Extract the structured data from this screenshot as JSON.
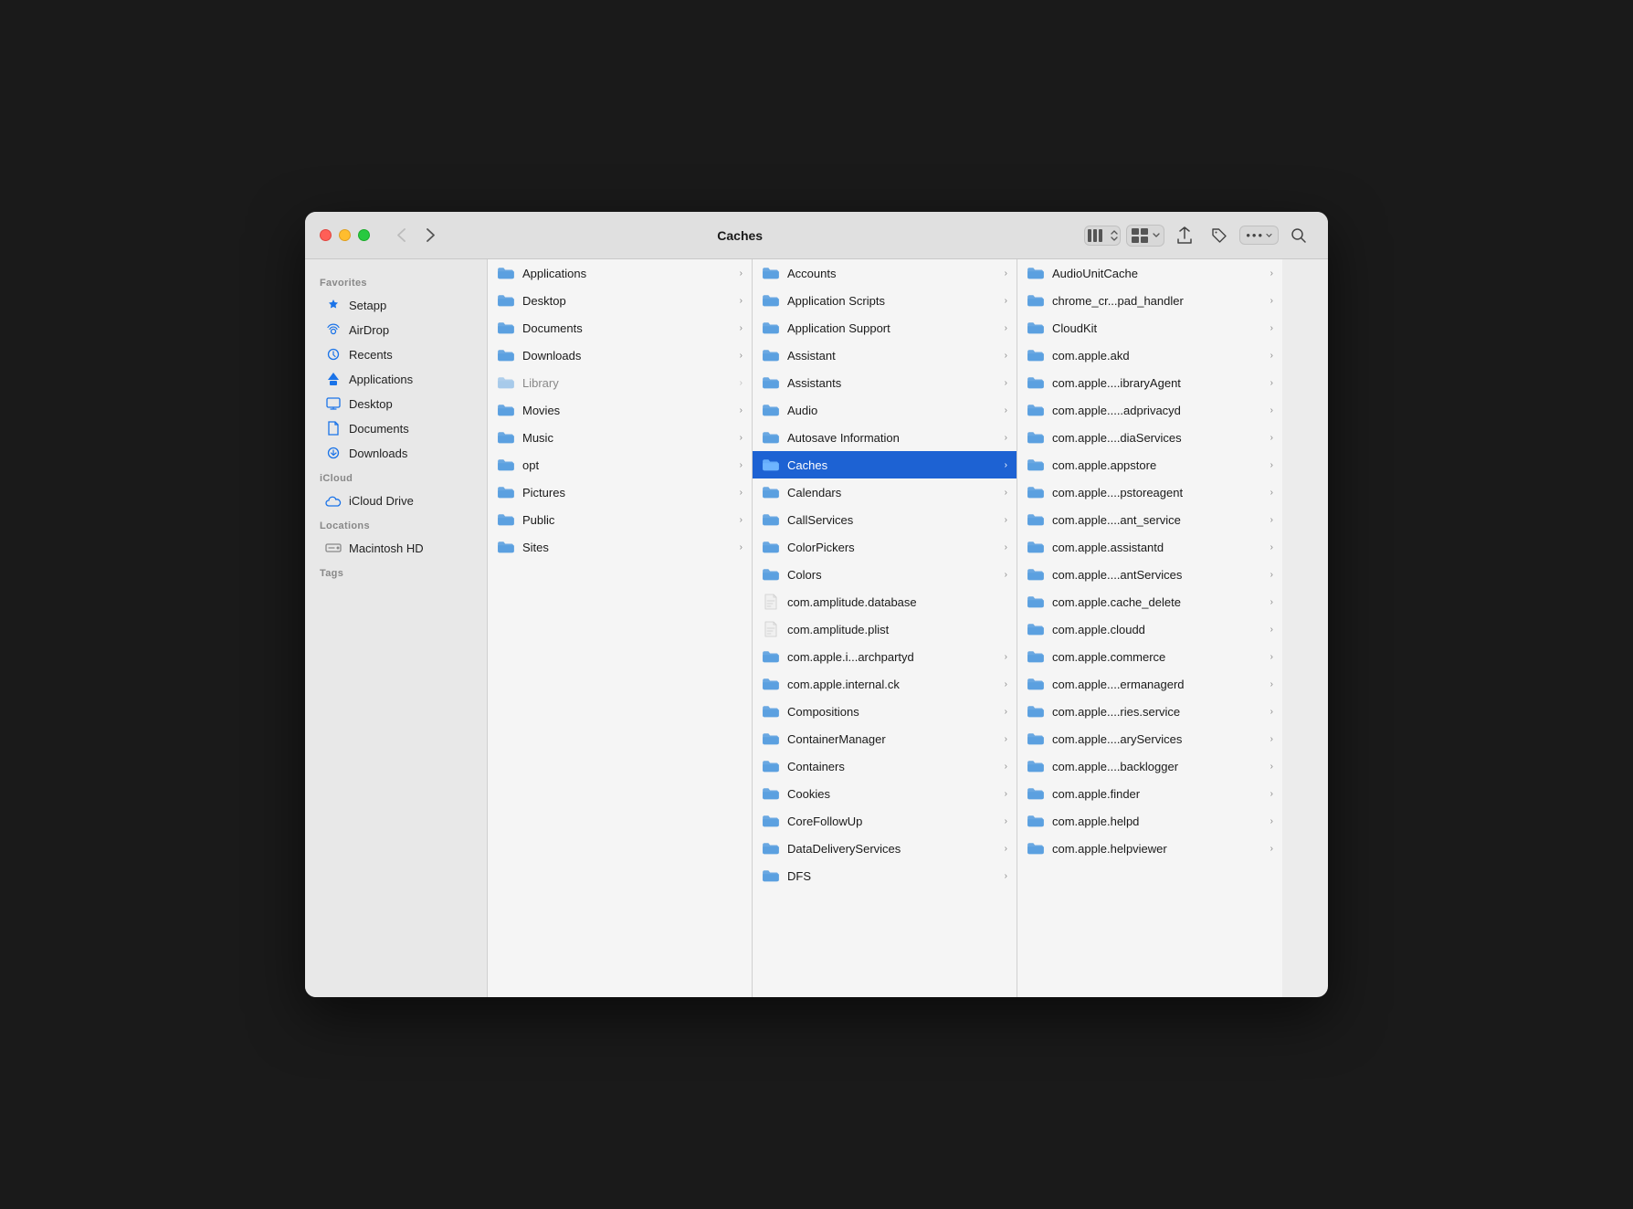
{
  "window": {
    "title": "Caches",
    "traffic_lights": {
      "red_label": "close",
      "yellow_label": "minimize",
      "green_label": "maximize"
    }
  },
  "toolbar": {
    "back_label": "‹",
    "forward_label": "›",
    "view_columns_icon": "⊞",
    "view_grid_icon": "⊞",
    "share_icon": "↑",
    "tag_icon": "🏷",
    "more_icon": "···",
    "search_icon": "⌕"
  },
  "sidebar": {
    "favorites_title": "Favorites",
    "favorites": [
      {
        "id": "setapp",
        "label": "Setapp",
        "icon": "✦",
        "color": "blue"
      },
      {
        "id": "airdrop",
        "label": "AirDrop",
        "icon": "📡",
        "color": "blue"
      },
      {
        "id": "recents",
        "label": "Recents",
        "icon": "🕐",
        "color": "blue"
      },
      {
        "id": "applications",
        "label": "Applications",
        "icon": "🚀",
        "color": "blue"
      },
      {
        "id": "desktop",
        "label": "Desktop",
        "icon": "🖥",
        "color": "blue"
      },
      {
        "id": "documents",
        "label": "Documents",
        "icon": "📄",
        "color": "blue"
      },
      {
        "id": "downloads",
        "label": "Downloads",
        "icon": "⬇",
        "color": "blue"
      }
    ],
    "icloud_title": "iCloud",
    "icloud": [
      {
        "id": "icloud-drive",
        "label": "iCloud Drive",
        "icon": "☁",
        "color": "blue"
      }
    ],
    "locations_title": "Locations",
    "locations": [
      {
        "id": "macintosh-hd",
        "label": "Macintosh HD",
        "icon": "🖴",
        "color": "gray"
      }
    ],
    "tags_title": "Tags"
  },
  "columns": {
    "col1": {
      "items": [
        {
          "id": "applications",
          "name": "Applications",
          "type": "folder",
          "hasArrow": true
        },
        {
          "id": "desktop",
          "name": "Desktop",
          "type": "folder",
          "hasArrow": true
        },
        {
          "id": "documents",
          "name": "Documents",
          "type": "folder",
          "hasArrow": true
        },
        {
          "id": "downloads",
          "name": "Downloads",
          "type": "folder",
          "hasArrow": true
        },
        {
          "id": "library",
          "name": "Library",
          "type": "folder",
          "hasArrow": true,
          "grayed": true
        },
        {
          "id": "movies",
          "name": "Movies",
          "type": "folder",
          "hasArrow": true
        },
        {
          "id": "music",
          "name": "Music",
          "type": "folder",
          "hasArrow": true
        },
        {
          "id": "opt",
          "name": "opt",
          "type": "folder",
          "hasArrow": true
        },
        {
          "id": "pictures",
          "name": "Pictures",
          "type": "folder",
          "hasArrow": true
        },
        {
          "id": "public",
          "name": "Public",
          "type": "folder",
          "hasArrow": true
        },
        {
          "id": "sites",
          "name": "Sites",
          "type": "folder",
          "hasArrow": true
        }
      ]
    },
    "col2": {
      "items": [
        {
          "id": "accounts",
          "name": "Accounts",
          "type": "folder",
          "hasArrow": true
        },
        {
          "id": "application-scripts",
          "name": "Application Scripts",
          "type": "folder",
          "hasArrow": true
        },
        {
          "id": "application-support",
          "name": "Application Support",
          "type": "folder",
          "hasArrow": true
        },
        {
          "id": "assistant",
          "name": "Assistant",
          "type": "folder",
          "hasArrow": true
        },
        {
          "id": "assistants",
          "name": "Assistants",
          "type": "folder",
          "hasArrow": true
        },
        {
          "id": "audio",
          "name": "Audio",
          "type": "folder",
          "hasArrow": true
        },
        {
          "id": "autosave-information",
          "name": "Autosave Information",
          "type": "folder",
          "hasArrow": true
        },
        {
          "id": "caches",
          "name": "Caches",
          "type": "folder",
          "hasArrow": true,
          "selected": true
        },
        {
          "id": "calendars",
          "name": "Calendars",
          "type": "folder",
          "hasArrow": true
        },
        {
          "id": "callservices",
          "name": "CallServices",
          "type": "folder",
          "hasArrow": true
        },
        {
          "id": "colorpickers",
          "name": "ColorPickers",
          "type": "folder",
          "hasArrow": true
        },
        {
          "id": "colors",
          "name": "Colors",
          "type": "folder",
          "hasArrow": true
        },
        {
          "id": "com-amplitude-database",
          "name": "com.amplitude.database",
          "type": "file",
          "hasArrow": false
        },
        {
          "id": "com-amplitude-plist",
          "name": "com.amplitude.plist",
          "type": "file",
          "hasArrow": false
        },
        {
          "id": "com-apple-i-archpartyd",
          "name": "com.apple.i...archpartyd",
          "type": "folder",
          "hasArrow": true
        },
        {
          "id": "com-apple-internal-ck",
          "name": "com.apple.internal.ck",
          "type": "folder",
          "hasArrow": true
        },
        {
          "id": "compositions",
          "name": "Compositions",
          "type": "folder",
          "hasArrow": true
        },
        {
          "id": "containermanager",
          "name": "ContainerManager",
          "type": "folder",
          "hasArrow": true
        },
        {
          "id": "containers",
          "name": "Containers",
          "type": "folder",
          "hasArrow": true
        },
        {
          "id": "cookies",
          "name": "Cookies",
          "type": "folder",
          "hasArrow": true
        },
        {
          "id": "corefollowup",
          "name": "CoreFollowUp",
          "type": "folder",
          "hasArrow": true
        },
        {
          "id": "datadeliveryservices",
          "name": "DataDeliveryServices",
          "type": "folder",
          "hasArrow": true
        },
        {
          "id": "dfs",
          "name": "DFS",
          "type": "folder",
          "hasArrow": true
        }
      ]
    },
    "col3": {
      "items": [
        {
          "id": "audiounitcache",
          "name": "AudioUnitCache",
          "type": "folder",
          "hasArrow": true
        },
        {
          "id": "chrome-cr-pad-handler",
          "name": "chrome_cr...pad_handler",
          "type": "folder",
          "hasArrow": true
        },
        {
          "id": "cloudkit",
          "name": "CloudKit",
          "type": "folder",
          "hasArrow": true
        },
        {
          "id": "com-apple-akd",
          "name": "com.apple.akd",
          "type": "folder",
          "hasArrow": true
        },
        {
          "id": "com-apple-ibraryagent",
          "name": "com.apple....ibraryAgent",
          "type": "folder",
          "hasArrow": true
        },
        {
          "id": "com-apple-adprivacyd",
          "name": "com.apple.....adprivacyd",
          "type": "folder",
          "hasArrow": true
        },
        {
          "id": "com-apple-diaservices",
          "name": "com.apple....diaServices",
          "type": "folder",
          "hasArrow": true
        },
        {
          "id": "com-apple-appstore",
          "name": "com.apple.appstore",
          "type": "folder",
          "hasArrow": true
        },
        {
          "id": "com-apple-pstoreagent",
          "name": "com.apple....pstoreagent",
          "type": "folder",
          "hasArrow": true
        },
        {
          "id": "com-apple-ant-service",
          "name": "com.apple....ant_service",
          "type": "folder",
          "hasArrow": true
        },
        {
          "id": "com-apple-assistantd",
          "name": "com.apple.assistantd",
          "type": "folder",
          "hasArrow": true
        },
        {
          "id": "com-apple-antservices",
          "name": "com.apple....antServices",
          "type": "folder",
          "hasArrow": true
        },
        {
          "id": "com-apple-cache-delete",
          "name": "com.apple.cache_delete",
          "type": "folder",
          "hasArrow": true
        },
        {
          "id": "com-apple-cloudd",
          "name": "com.apple.cloudd",
          "type": "folder",
          "hasArrow": true
        },
        {
          "id": "com-apple-commerce",
          "name": "com.apple.commerce",
          "type": "folder",
          "hasArrow": true
        },
        {
          "id": "com-apple-ermanagerd",
          "name": "com.apple....ermanagerd",
          "type": "folder",
          "hasArrow": true
        },
        {
          "id": "com-apple-ries-service",
          "name": "com.apple....ries.service",
          "type": "folder",
          "hasArrow": true,
          "hasSpecialIcon": true
        },
        {
          "id": "com-apple-aryservices",
          "name": "com.apple....aryServices",
          "type": "folder",
          "hasArrow": true
        },
        {
          "id": "com-apple-backlogger",
          "name": "com.apple....backlogger",
          "type": "folder",
          "hasArrow": true
        },
        {
          "id": "com-apple-finder",
          "name": "com.apple.finder",
          "type": "folder",
          "hasArrow": true
        },
        {
          "id": "com-apple-helpd",
          "name": "com.apple.helpd",
          "type": "folder",
          "hasArrow": true
        },
        {
          "id": "com-apple-helpviewer",
          "name": "com.apple.helpviewer",
          "type": "folder",
          "hasArrow": true
        }
      ]
    }
  }
}
